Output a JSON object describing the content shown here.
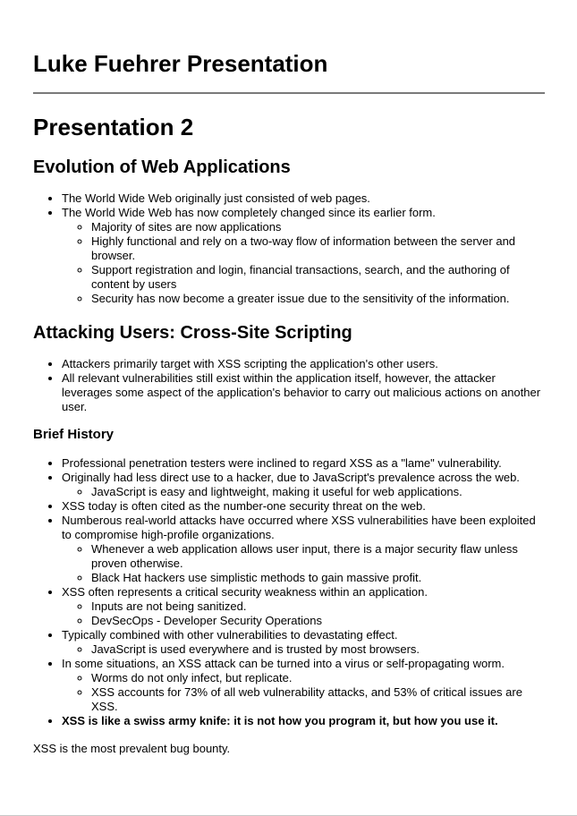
{
  "site_title": "Luke Fuehrer Presentation",
  "presentation_title": "Presentation 2",
  "sections": {
    "evolution": {
      "title": "Evolution of Web Applications",
      "item1": "The World Wide Web originally just consisted of web pages.",
      "item2": "The World Wide Web has now completely changed since its earlier form.",
      "item2_sub": [
        "Majority of sites are now applications",
        "Highly functional and rely on a two-way flow of information between the server and browser.",
        "Support registration and login, financial transactions, search, and the authoring of content by users",
        "Security has now become a greater issue due to the sensitivity of the information."
      ]
    },
    "xss": {
      "title": "Attacking Users: Cross-Site Scripting",
      "items": [
        "Attackers primarily target with XSS scripting the application's other users.",
        "All relevant vulnerabilities still exist within the application itself, however, the attacker leverages some aspect of the application's behavior to carry out malicious actions on another user."
      ]
    },
    "history": {
      "title": "Brief History",
      "i1": "Professional penetration testers were inclined to regard XSS as a \"lame\" vulnerability.",
      "i2": "Originally had less direct use to a hacker, due to JavaScript's prevalence across the web.",
      "i2_sub": [
        "JavaScript is easy and lightweight, making it useful for web applications."
      ],
      "i3": "XSS today is often cited as the number-one security threat on the web.",
      "i4": "Numberous real-world attacks have occurred where XSS vulnerabilities have been exploited to compromise high-profile organizations.",
      "i4_sub": [
        "Whenever a web application allows user input, there is a major security flaw unless proven otherwise.",
        "Black Hat hackers use simplistic methods to gain massive profit."
      ],
      "i5": "XSS often represents a critical security weakness within an application.",
      "i5_sub": [
        "Inputs are not being sanitized.",
        "DevSecOps - Developer Security Operations"
      ],
      "i6": "Typically combined with other vulnerabilities to devastating effect.",
      "i6_sub": [
        "JavaScript is used everywhere and is trusted by most browsers."
      ],
      "i7": "In some situations, an XSS attack can be turned into a virus or self-propagating worm.",
      "i7_sub": [
        "Worms do not only infect, but replicate.",
        "XSS accounts for 73% of all web vulnerability attacks, and 53% of critical issues are XSS."
      ],
      "i8": "XSS is like a swiss army knife: it is not how you program it, but how you use it."
    }
  },
  "closing_note": "XSS is the most prevalent bug bounty."
}
